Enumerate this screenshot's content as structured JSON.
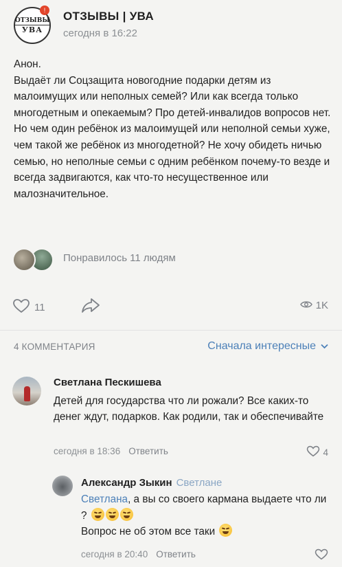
{
  "header": {
    "avatar_line1": "ОТЗЫВЫ",
    "avatar_line2": "УВА",
    "avatar_badge": "!",
    "group_name": "ОТЗЫВЫ | УВА",
    "time": "сегодня в 16:22"
  },
  "post": {
    "paragraphs": [
      "Анон.",
      "Выдаёт ли Соцзащита новогодние подарки детям из малоимущих или неполных семей? Или как всегда только многодетным и опекаемым? Про детей-инвалидов вопросов нет. Но чем один ребёнок из малоимущей или неполной семьи хуже, чем такой же ребёнок из многодетной? Не хочу обидеть ничью семью, но неполные семьи с одним ребёнком почему-то везде и всегда задвигаются, как что-то несущественное или малозначительное."
    ],
    "likes_text": "Понравилось 11 людям",
    "like_count": "11",
    "views": "1K"
  },
  "comments_header": {
    "count_label": "4 КОММЕНТАРИЯ",
    "sort_label": "Сначала интересные"
  },
  "comments": [
    {
      "author": "Светлана Пескишева",
      "text": "Детей для государства что ли рожали? Все каких-то денег ждут, подарков. Как родили, так и обеспечивайте",
      "time": "сегодня в 18:36",
      "reply_label": "Ответить",
      "likes": "4"
    },
    {
      "author": "Александр Зыкин",
      "reply_to": "Светлане",
      "mention": "Светлана",
      "text_line1": ", а вы со своего кармана выдаете что ли ?",
      "text_line2": "Вопрос не об этом все таки",
      "time": "сегодня в 20:40",
      "reply_label": "Ответить",
      "likes": ""
    }
  ],
  "icons": {
    "heart": "heart-icon",
    "share": "share-arrow-icon",
    "views": "eye-icon",
    "chevron": "chevron-down-icon",
    "emoji": "rofl-emoji-icon"
  },
  "colors": {
    "background": "#f4f4f2",
    "link": "#4c80b8",
    "secondary_text": "#8b8f93"
  }
}
